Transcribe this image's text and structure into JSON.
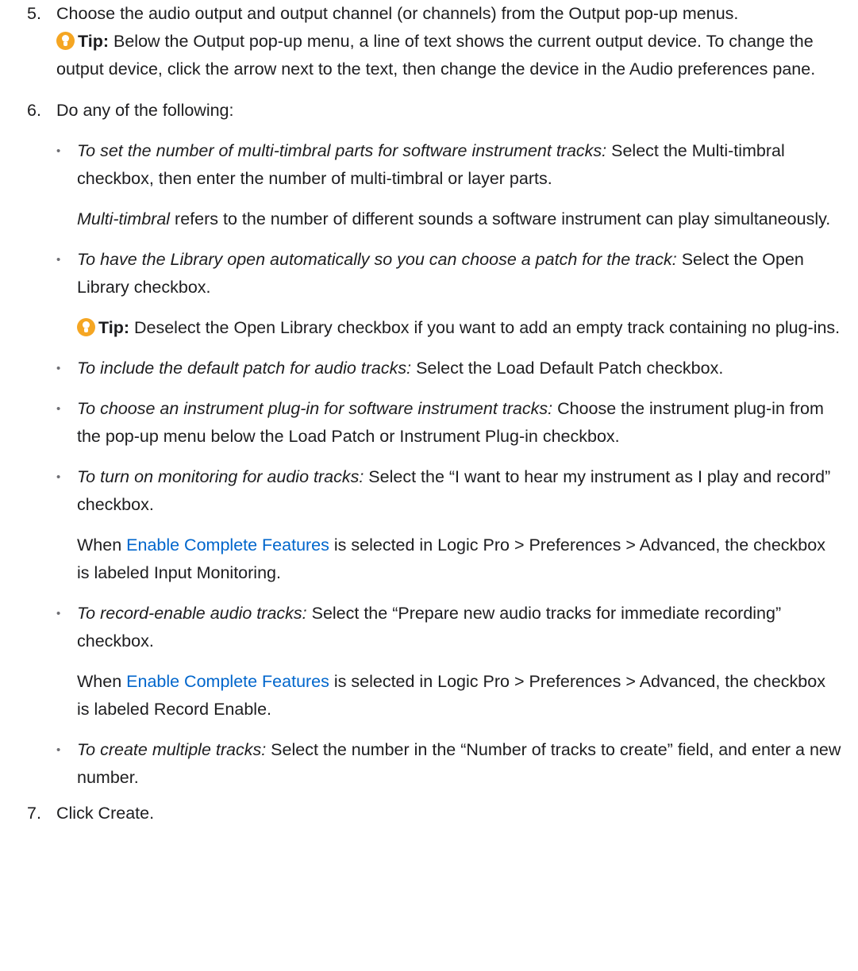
{
  "steps": [
    {
      "number": "5.",
      "text": "Choose the audio output and output channel (or channels) from the Output pop-up menus.",
      "tip_label": "Tip:",
      "tip_text": " Below the Output pop-up menu, a line of text shows the current output device. To change the output device, click the arrow next to the text, then change the device in the Audio preferences pane."
    },
    {
      "number": "6.",
      "text": "Do any of the following:",
      "bullets": {
        "b1_em": "To set the number of multi-timbral parts for software instrument tracks:",
        "b1_text": " Select the Multi-timbral checkbox, then enter the number of multi-timbral or layer parts.",
        "b1_sub_em": "Multi-timbral",
        "b1_sub_text": " refers to the number of different sounds a software instrument can play simultaneously.",
        "b2_em": "To have the Library open automatically so you can choose a patch for the track:",
        "b2_text": " Select the Open Library checkbox.",
        "b2_tip_label": "Tip:",
        "b2_tip_text": " Deselect the Open Library checkbox if you want to add an empty track containing no plug-ins.",
        "b3_em": "To include the default patch for audio tracks:",
        "b3_text": " Select the Load Default Patch checkbox.",
        "b4_em": "To choose an instrument plug-in for software instrument tracks:",
        "b4_text": " Choose the instrument plug-in from the pop-up menu below the Load Patch or Instrument Plug-in checkbox.",
        "b5_em": "To turn on monitoring for audio tracks:",
        "b5_text": " Select the “I want to hear my instrument as I play and record” checkbox.",
        "b5_sub_pre": "When ",
        "b5_sub_link": "Enable Complete Features",
        "b5_sub_post": " is selected in Logic Pro > Preferences > Advanced, the checkbox is labeled Input Monitoring.",
        "b6_em": "To record-enable audio tracks:",
        "b6_text": " Select the “Prepare new audio tracks for immediate recording” checkbox.",
        "b6_sub_pre": "When ",
        "b6_sub_link": "Enable Complete Features",
        "b6_sub_post": " is selected in Logic Pro > Preferences > Advanced, the checkbox is labeled Record Enable.",
        "b7_em": "To create multiple tracks:",
        "b7_text": " Select the number in the “Number of tracks to create” field, and enter a new number."
      }
    },
    {
      "number": "7.",
      "text": "Click Create."
    }
  ],
  "colors": {
    "link": "#0066cc",
    "tip_icon": "#f5a623",
    "text": "#1d1d1f"
  },
  "icons": {
    "tip": "lightbulb-icon"
  }
}
